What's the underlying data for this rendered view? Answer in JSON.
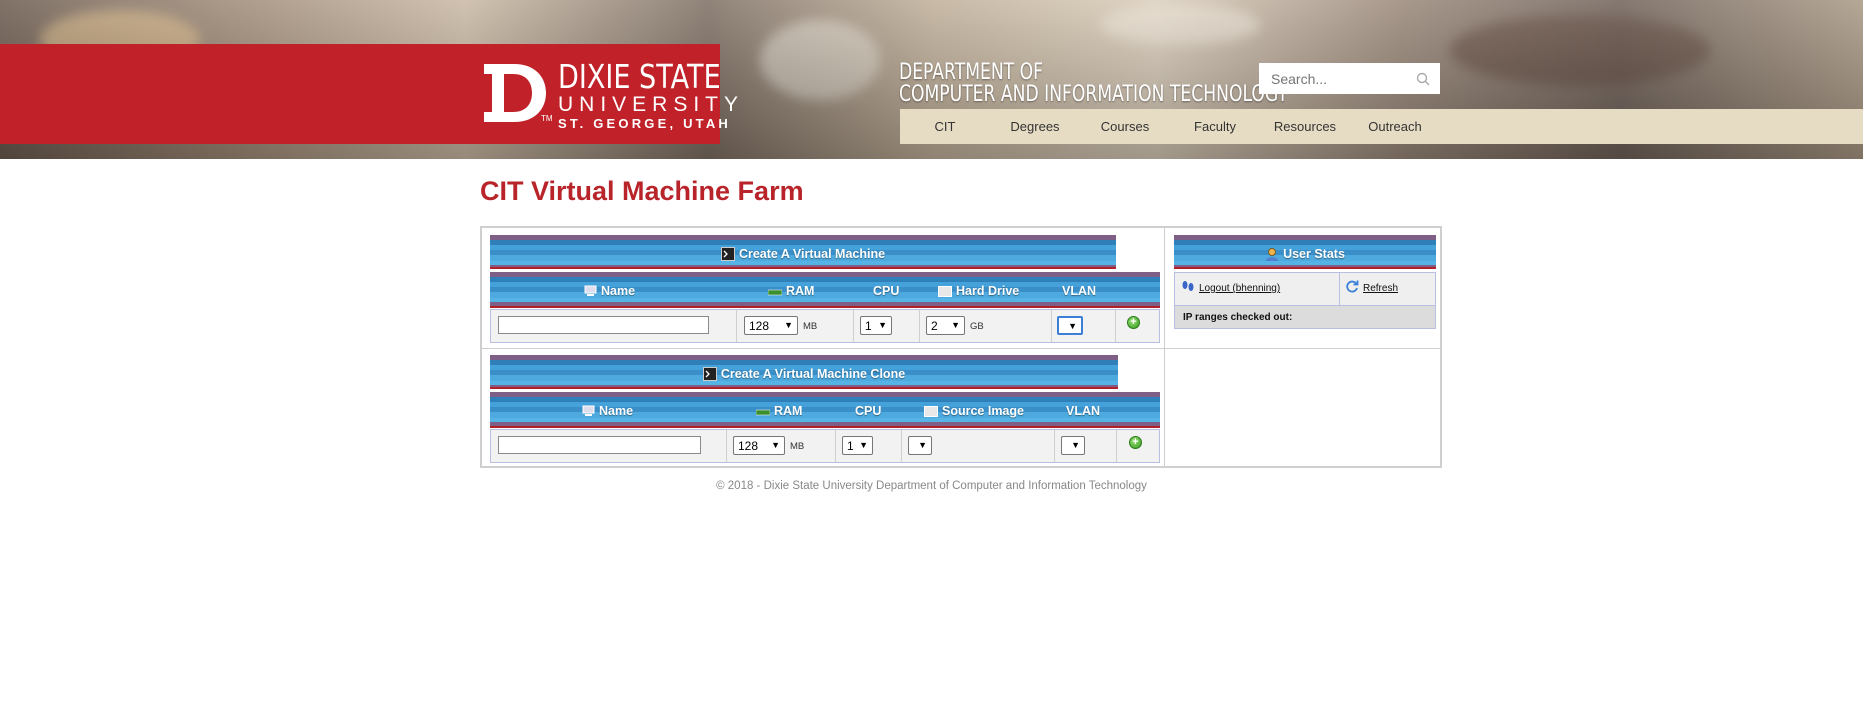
{
  "header": {
    "university_line1": "DIXIE STATE",
    "university_line2": "UNIVERSITY",
    "university_line3": "ST. GEORGE, UTAH",
    "tm": "TM",
    "department_line1": "DEPARTMENT OF",
    "department_line2": "COMPUTER AND INFORMATION TECHNOLOGY",
    "search_placeholder": "Search...",
    "nav": [
      "CIT",
      "Degrees",
      "Courses",
      "Faculty",
      "Resources",
      "Outreach"
    ]
  },
  "page_title": "CIT Virtual Machine Farm",
  "create_vm": {
    "title": "Create A Virtual Machine",
    "columns": {
      "name": "Name",
      "ram": "RAM",
      "cpu": "CPU",
      "disk": "Hard Drive",
      "vlan": "VLAN"
    },
    "ram_value": "128",
    "ram_unit": "MB",
    "cpu_value": "1",
    "disk_value": "2",
    "disk_unit": "GB",
    "vlan_value": ""
  },
  "create_clone": {
    "title": "Create A Virtual Machine Clone",
    "columns": {
      "name": "Name",
      "ram": "RAM",
      "cpu": "CPU",
      "source": "Source Image",
      "vlan": "VLAN"
    },
    "ram_value": "128",
    "ram_unit": "MB",
    "cpu_value": "1",
    "source_value": "",
    "vlan_value": ""
  },
  "user_stats": {
    "title": "User Stats",
    "logout_label": "Logout (bhenning)",
    "refresh_label": "Refresh",
    "ip_ranges_label": "IP ranges checked out:"
  },
  "footer": "© 2018 - Dixie State University Department of Computer and Information Technology",
  "colors": {
    "brand_red": "#c1222a",
    "title_red": "#b8242a",
    "nav_bg": "#e6dcc4",
    "header_blue": "#45a1d9"
  }
}
